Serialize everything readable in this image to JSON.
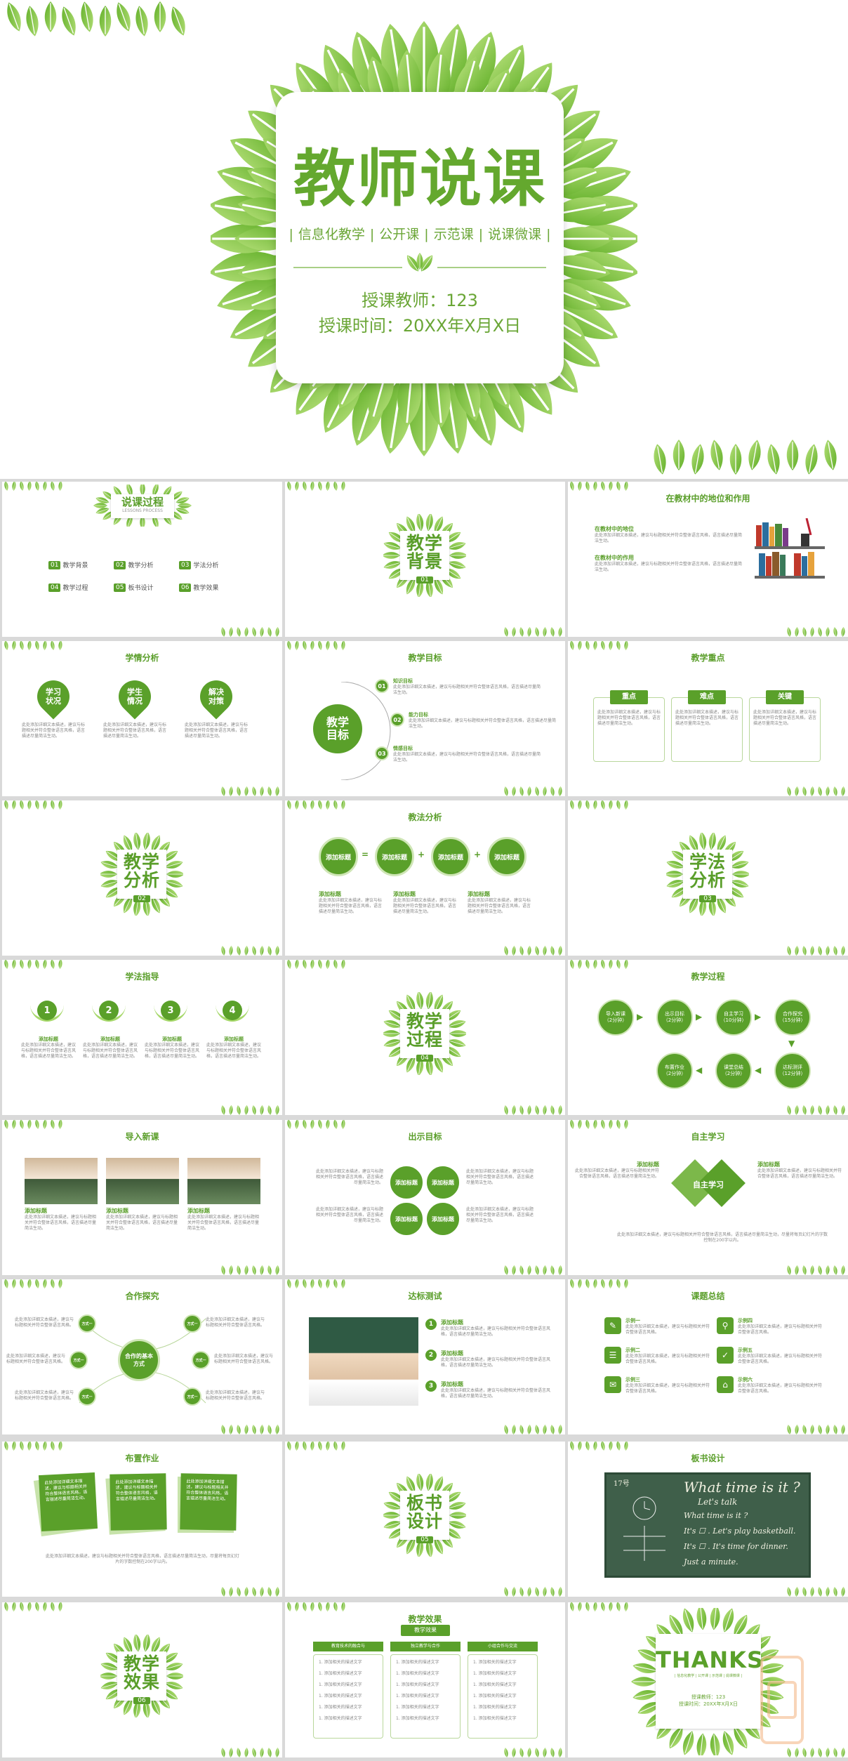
{
  "hero": {
    "title": "教师说课",
    "tags": [
      "信息化教学",
      "公开课",
      "示范课",
      "说课微课"
    ],
    "teacher": "授课教师：123",
    "time": "授课时间：20XX年X月X日"
  },
  "toc": {
    "title": "说课过程",
    "subtitle": "LESSONS PROCESS",
    "items": [
      {
        "num": "01",
        "label": "教学背景"
      },
      {
        "num": "02",
        "label": "教学分析"
      },
      {
        "num": "03",
        "label": "学法分析"
      },
      {
        "num": "04",
        "label": "教学过程"
      },
      {
        "num": "05",
        "label": "板书设计"
      },
      {
        "num": "06",
        "label": "教学效果"
      }
    ]
  },
  "sections": {
    "s01": {
      "line1": "教学",
      "line2": "背景",
      "num": "01"
    },
    "s02": {
      "line1": "教学",
      "line2": "分析",
      "num": "02"
    },
    "s03": {
      "line1": "学法",
      "line2": "分析",
      "num": "03"
    },
    "s04": {
      "line1": "教学",
      "line2": "过程",
      "num": "04"
    },
    "s05": {
      "line1": "板书",
      "line2": "设计",
      "num": "05"
    },
    "s06": {
      "line1": "教学",
      "line2": "效果",
      "num": "06"
    }
  },
  "placeholder": "此处添加详细文本描述，建议与标题相关并符合整体语言风格，语言描述尽量简洁生动。",
  "placeholder_short": "此处添加详细文本描述，建议与标题相关并符合整体语言风格。",
  "add_title": "添加标题",
  "status_text": "此处添加详细文本描述，建议与标题相关并符合整体语言风格，语言描述尽量简洁生动，尽量将每页幻灯片的字数控制在200字以内。",
  "s3": {
    "title": "在教材中的地位和作用",
    "h1": "在教材中的地位",
    "h2": "在教材中的作用"
  },
  "s4": {
    "title": "学情分析",
    "c1": [
      "学习",
      "状况"
    ],
    "c2": [
      "学生",
      "情况"
    ],
    "c3": [
      "解决",
      "对策"
    ]
  },
  "s5": {
    "title": "教学目标",
    "center": [
      "教学",
      "目标"
    ],
    "items": [
      {
        "num": "01",
        "label": "知识目标"
      },
      {
        "num": "02",
        "label": "能力目标"
      },
      {
        "num": "03",
        "label": "情感目标"
      }
    ]
  },
  "s6": {
    "title": "教学重点",
    "tabs": [
      "重点",
      "难点",
      "关键"
    ]
  },
  "s8": {
    "title": "教法分析",
    "ops": [
      "=",
      "+",
      "+"
    ]
  },
  "s10": {
    "title": "学法指导",
    "nums": [
      "1",
      "2",
      "3",
      "4"
    ]
  },
  "s12": {
    "title": "教学过程",
    "steps": [
      {
        "label": "导入新课",
        "time": "（2分钟）"
      },
      {
        "label": "出示目标",
        "time": "（2分钟）"
      },
      {
        "label": "自主学习",
        "time": "（10分钟）"
      },
      {
        "label": "合作探究",
        "time": "（15分钟）"
      },
      {
        "label": "布置作业",
        "time": "（2分钟）"
      },
      {
        "label": "课堂总结",
        "time": "（2分钟）"
      },
      {
        "label": "达标测评",
        "time": "（12分钟）"
      }
    ]
  },
  "s13": {
    "title": "导入新课"
  },
  "s14": {
    "title": "出示目标"
  },
  "s15": {
    "title": "自主学习",
    "center": "自主学习"
  },
  "s16": {
    "title": "合作探究",
    "center": "合作的基本方式",
    "way": "方式一"
  },
  "s17": {
    "title": "达标测试",
    "nums": [
      "1",
      "2",
      "3"
    ]
  },
  "s18": {
    "title": "课题总结",
    "items": [
      "示例一",
      "示例二",
      "示例三",
      "示例四",
      "示例五",
      "示例六"
    ]
  },
  "s19": {
    "title": "布置作业"
  },
  "s21": {
    "title": "板书设计",
    "board": {
      "date": "17号",
      "heading": "What time is it ?",
      "sub": "Let's talk",
      "q": "What time is it ?",
      "l1": "It's ☐ .  Let's play basketball.",
      "l2": "It's ☐ .  It's time for dinner.",
      "l3": "Just a minute."
    }
  },
  "s23": {
    "title": "教学效果",
    "banner": "教学效果",
    "cols": [
      "教育技术的融合与",
      "独立教学与合作",
      "小组合作与交流"
    ],
    "row": "1. 添加相关的描述文字"
  },
  "s24": {
    "big": "THANKS",
    "tags": "| 信息化教学 | 公开课 | 示范课 | 说课微课 |",
    "teacher": "授课教师：123",
    "time": "授课时间：20XX年X月X日"
  },
  "colors": {
    "green": "#5aa02a",
    "leaf_dark": "#6ab62e",
    "leaf_light": "#a6d86a",
    "text_green": "#64a82e"
  }
}
